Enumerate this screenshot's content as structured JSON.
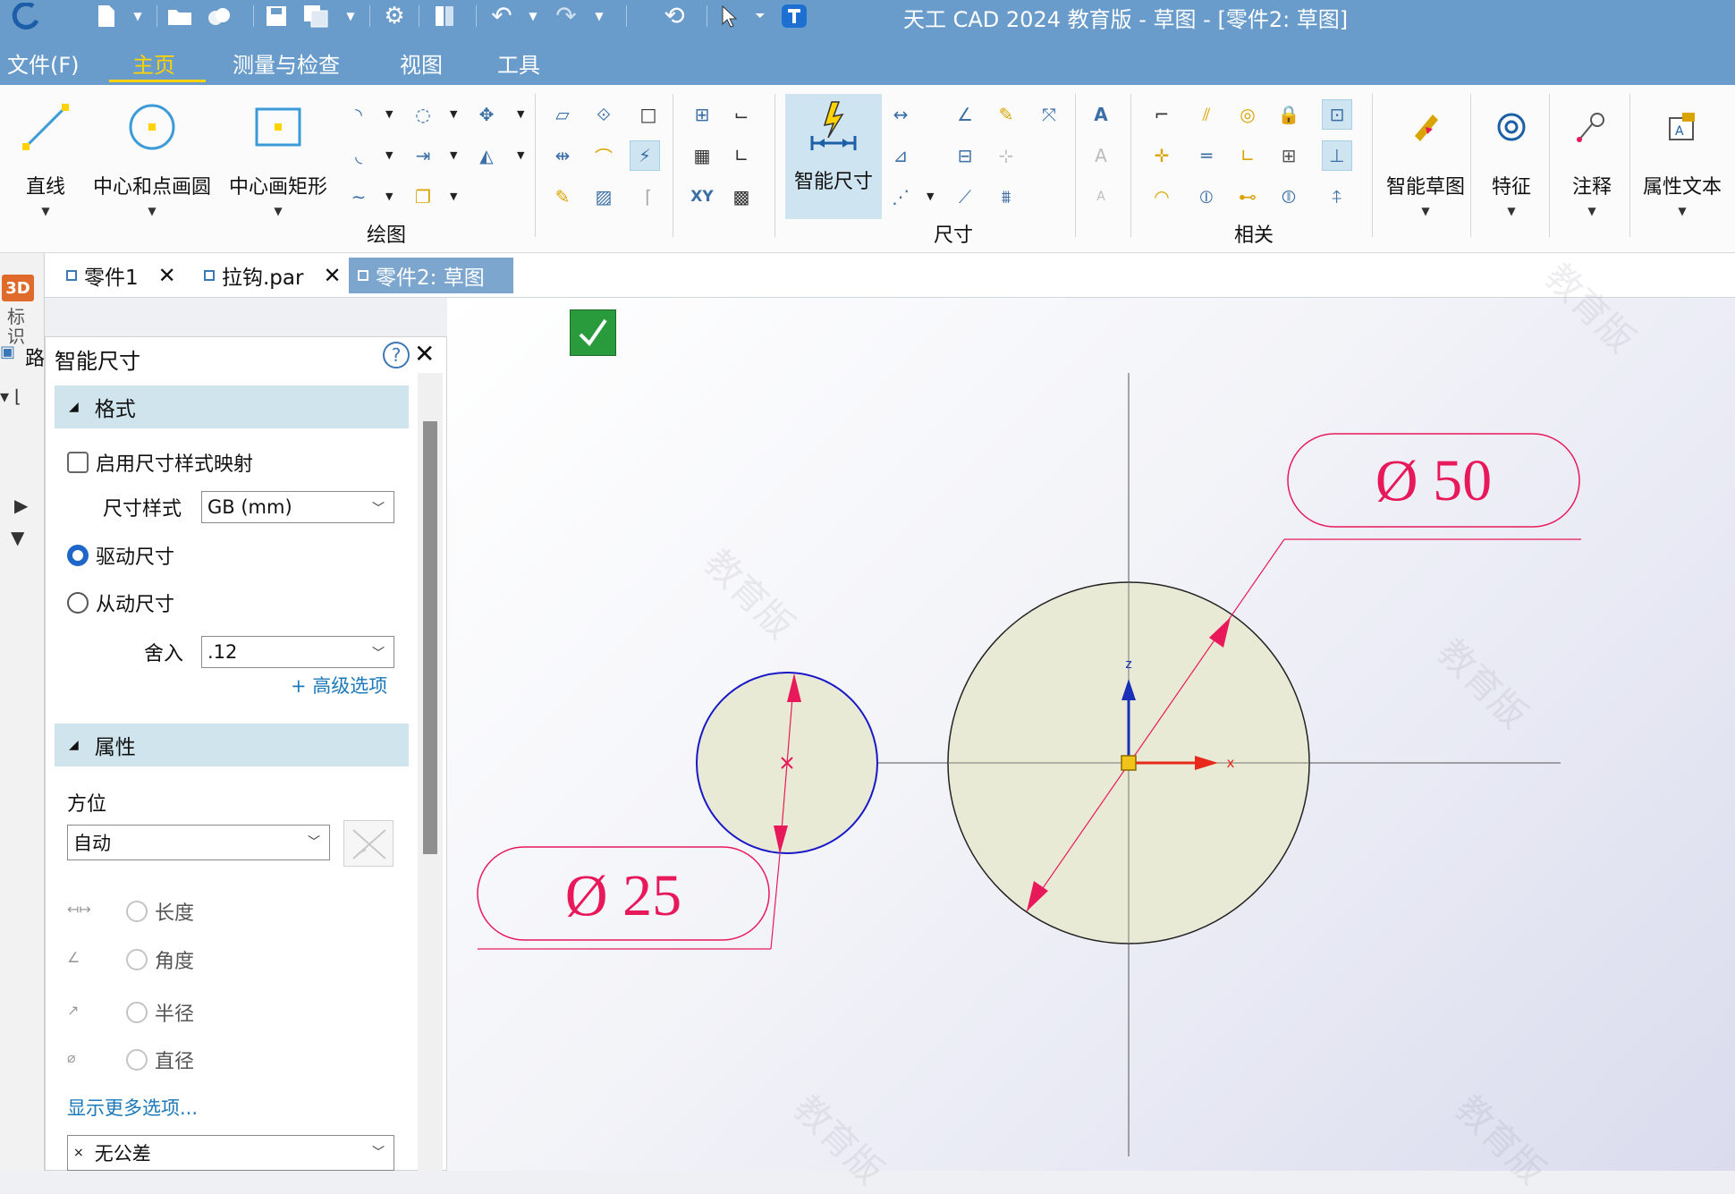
{
  "window": {
    "title": "天工 CAD 2024 教育版 - 草图 - [零件2: 草图]"
  },
  "menu": {
    "items": [
      "文件(F)",
      "主页",
      "测量与检查",
      "视图",
      "工具"
    ],
    "active_index": 1
  },
  "ribbon": {
    "buttons": {
      "line": "直线",
      "circle_center": "中心和点画圆",
      "rect_center": "中心画矩形",
      "smart_dimension": "智能尺寸",
      "smart_sketch": "智能草图",
      "feature": "特征",
      "annotation": "注释",
      "attribute_text": "属性文本"
    },
    "groups": {
      "draw": "绘图",
      "dimension": "尺寸",
      "relate": "相关"
    },
    "small_labels": {
      "xy": "XY"
    }
  },
  "tabs": [
    {
      "label": "零件1",
      "active": false
    },
    {
      "label": "拉钩.par",
      "active": false
    },
    {
      "label": "零件2: 草图",
      "active": true
    }
  ],
  "left_strip": {
    "badge": "3D",
    "vertical": "标识",
    "road": "路"
  },
  "panel": {
    "title": "智能尺寸",
    "help": "?",
    "close": "✕",
    "format": {
      "header": "格式",
      "enable_mapping": "启用尺寸样式映射",
      "style_label": "尺寸样式",
      "style_value": "GB (mm)",
      "driving": "驱动尺寸",
      "driven": "从动尺寸",
      "round_label": "舍入",
      "round_value": ".12",
      "advanced": "+ 高级选项"
    },
    "properties": {
      "header": "属性",
      "orientation_label": "方位",
      "orientation_value": "自动",
      "length": "长度",
      "angle": "角度",
      "radius": "半径",
      "diameter": "直径",
      "more": "显示更多选项...",
      "tolerance_value": "无公差"
    }
  },
  "sketch": {
    "dim_large": "Ø  50",
    "dim_small": "Ø  25",
    "axis_z": "z",
    "axis_x": "x",
    "watermark": "教育版"
  },
  "colors": {
    "title_bar": "#6a9ccb",
    "active_menu": "#ffd200",
    "dimension": "#e8195a",
    "small_circle": "#1818c8",
    "circle_fill": "#e9ead6",
    "confirm": "#2a9b3c"
  }
}
